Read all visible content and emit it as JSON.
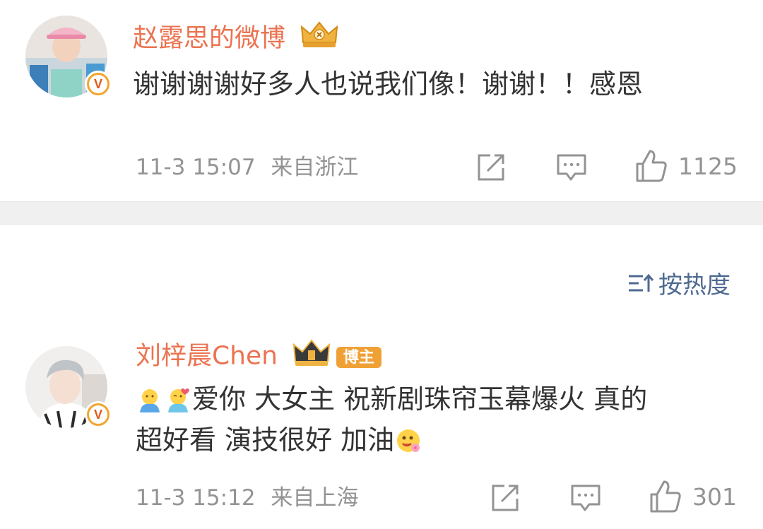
{
  "comments": [
    {
      "username": "赵露思的微博",
      "text": "谢谢谢谢好多人也说我们像！谢谢！！感恩",
      "time": "11-3 15:07",
      "location": "来自浙江",
      "likes": "1125",
      "avatar_badge": "V"
    },
    {
      "username": "刘梓晨Chen",
      "badge": "博主",
      "text_line1": "爱你 大女主 祝新剧珠帘玉幕爆火 真的",
      "text_line2": "超好看 演技很好 加油",
      "time": "11-3 15:12",
      "location": "来自上海",
      "likes": "301",
      "avatar_badge": "V"
    }
  ],
  "sort": {
    "label": "按热度"
  },
  "icons": {
    "share": "share-icon",
    "comment": "comment-icon",
    "like": "like-icon",
    "sort": "sort-icon",
    "crown": "crown-icon"
  },
  "colors": {
    "username": "#eb7350",
    "text": "#333333",
    "meta": "#939393",
    "sort": "#4e6a91",
    "badge": "#f0a136"
  }
}
